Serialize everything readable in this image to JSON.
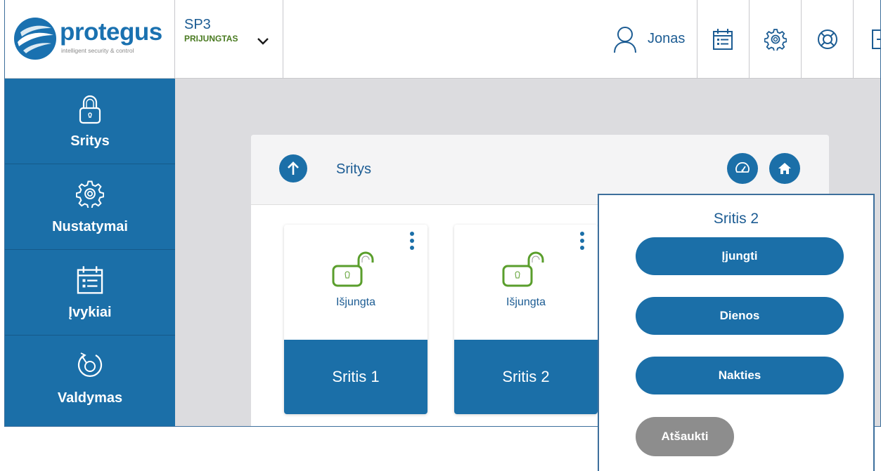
{
  "header": {
    "brand": "protegus",
    "tagline": "intelligent security & control",
    "system_name": "SP3",
    "system_status": "PRIJUNGTAS",
    "user_name": "Jonas",
    "icons": [
      "calendar-icon",
      "gear-icon",
      "lifebuoy-icon",
      "logout-icon"
    ]
  },
  "sidebar": {
    "items": [
      {
        "label": "Sritys",
        "icon": "padlock-icon"
      },
      {
        "label": "Nustatymai",
        "icon": "gear-icon"
      },
      {
        "label": "Įvykiai",
        "icon": "calendar-icon"
      },
      {
        "label": "Valdymas",
        "icon": "dial-icon"
      }
    ]
  },
  "main": {
    "title": "Sritys",
    "areas": [
      {
        "name": "Sritis 1",
        "state": "Išjungta"
      },
      {
        "name": "Sritis 2",
        "state": "Išjungta"
      }
    ]
  },
  "popup": {
    "title": "Sritis 2",
    "buttons": [
      "Įjungti",
      "Dienos",
      "Nakties"
    ],
    "cancel": "Atšaukti"
  },
  "colors": {
    "primary": "#1b6fa8",
    "status_green": "#497a20",
    "lock_green": "#5a9e2c",
    "background": "#dcdcdf",
    "cancel_gray": "#8d8d8d"
  }
}
